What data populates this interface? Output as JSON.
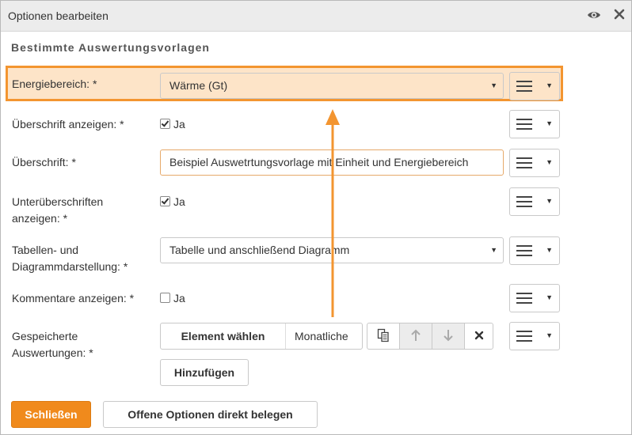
{
  "dialog": {
    "title": "Optionen bearbeiten",
    "eye_icon": "eye-icon",
    "close_icon": "close-icon"
  },
  "section_title": "Bestimmte Auswertungsvorlagen",
  "fields": {
    "energiebereich": {
      "label": "Energiebereich: *",
      "value": "Wärme (Gt)"
    },
    "ueberschrift_anzeigen": {
      "label": "Überschrift anzeigen: *",
      "checked": true,
      "text": "Ja"
    },
    "ueberschrift": {
      "label": "Überschrift: *",
      "value": "Beispiel Auswetrtungsvorlage mit Einheit und Energiebereich"
    },
    "unterueberschriften": {
      "label_line1": "Unterüberschriften",
      "label_line2": "anzeigen: *",
      "checked": true,
      "text": "Ja"
    },
    "darstellung": {
      "label_line1": "Tabellen- und",
      "label_line2": "Diagrammdarstellung: *",
      "value": "Tabelle und anschließend Diagramm"
    },
    "kommentare": {
      "label": "Kommentare anzeigen: *",
      "checked": false,
      "text": "Ja"
    },
    "gespeicherte": {
      "label_line1": "Gespeicherte",
      "label_line2": "Auswertungen: *",
      "element_button": "Element wählen",
      "element_value": "Monatliche"
    }
  },
  "buttons": {
    "add": "Hinzufügen",
    "close": "Schließen",
    "fill_open": "Offene Optionen direkt belegen"
  },
  "colors": {
    "accent": "#f08a1c",
    "highlight_border": "#f39530",
    "highlight_fill": "#fde4c8"
  }
}
